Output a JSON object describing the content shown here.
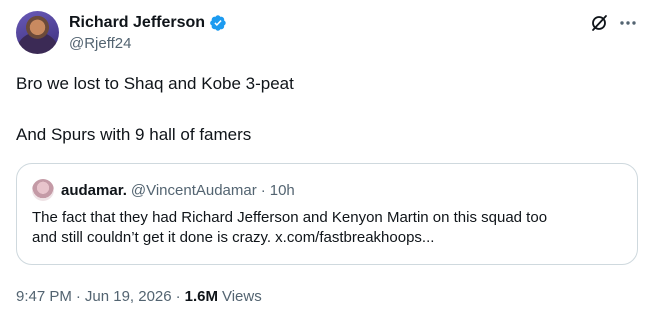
{
  "author": {
    "display_name": "Richard Jefferson",
    "handle": "@Rjeff24",
    "verified_color": "#1d9bf0"
  },
  "tweet": {
    "line1": "Bro we lost to Shaq and Kobe 3-peat",
    "line2": "And Spurs with 9 hall of famers"
  },
  "quote": {
    "display_name": "audamar.",
    "handle": "@VincentAudamar",
    "separator": "·",
    "time": "10h",
    "text_line1": "The fact that they had Richard Jefferson and Kenyon Martin on this squad too",
    "text_line2": "and still couldn’t get it done is crazy. x.com/fastbreakhoops..."
  },
  "meta": {
    "time": "9:47 PM",
    "separator1": "·",
    "date": "Jun 19, 2026",
    "separator2": "·",
    "views_count": "1.6M",
    "views_label": "Views"
  },
  "icons": {
    "top_right": [
      "grok-icon",
      "more-icon"
    ]
  },
  "colors": {
    "text_primary": "#0f1419",
    "text_secondary": "#536471",
    "border": "#cfd9de",
    "accent": "#1d9bf0"
  }
}
